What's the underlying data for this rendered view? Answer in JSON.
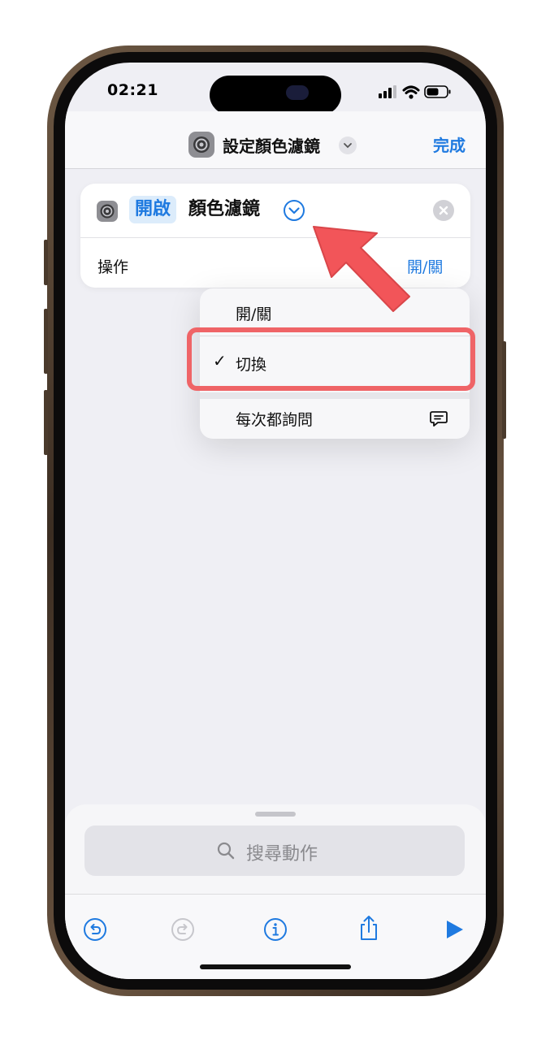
{
  "status_bar": {
    "time": "02:21"
  },
  "nav": {
    "title": "設定顏色濾鏡",
    "done_label": "完成"
  },
  "action_card": {
    "token": "開啟",
    "label": "顏色濾鏡",
    "parameter_label": "操作",
    "parameter_value": "開/關"
  },
  "menu": {
    "items": [
      {
        "label": "開/關",
        "checked": false
      },
      {
        "label": "切換",
        "checked": true
      },
      {
        "label": "每次都詢問",
        "checked": false
      }
    ],
    "check_glyph": "✓"
  },
  "search": {
    "placeholder": "搜尋動作"
  },
  "toolbar": {
    "icons": [
      "undo-icon",
      "redo-icon",
      "info-icon",
      "share-icon",
      "play-icon"
    ]
  },
  "colors": {
    "accent": "#1f7ae0",
    "highlight": "#ef6467",
    "token_bg": "#dcecfb"
  }
}
